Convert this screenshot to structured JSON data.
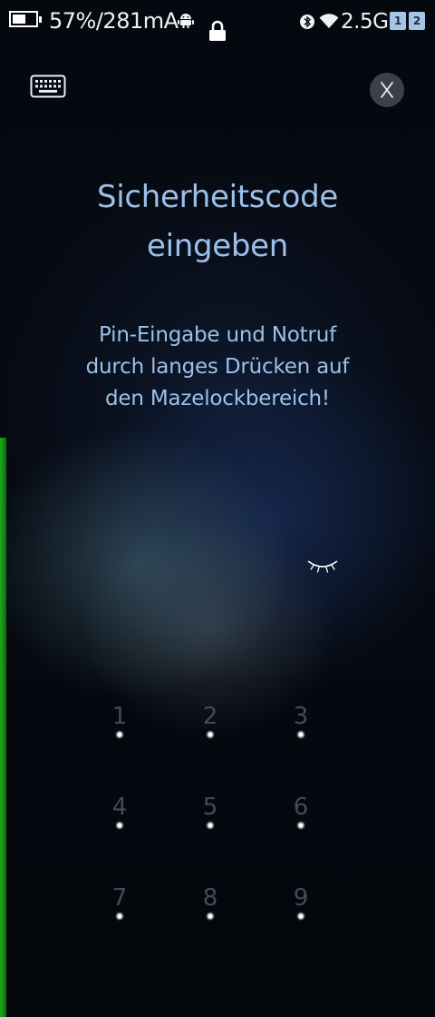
{
  "status_bar": {
    "battery_text": "57%/281mA",
    "network_text": "2.5G",
    "sim1": "1",
    "sim2": "2",
    "icons": [
      "battery-icon",
      "android-icon",
      "lock-icon",
      "bluetooth-icon",
      "wifi-icon",
      "sim1-icon",
      "sim2-icon"
    ]
  },
  "top_actions": {
    "keyboard_icon": "keyboard-icon",
    "close_icon": "close-icon"
  },
  "title": "Sicherheitscode\neingeben",
  "subtitle": "Pin-Eingabe und Notruf\ndurch langes Drücken auf\nden Mazelockbereich!",
  "visibility_icon": "eye-closed-icon",
  "keypad": {
    "keys": [
      "1",
      "2",
      "3",
      "4",
      "5",
      "6",
      "7",
      "8",
      "9"
    ]
  },
  "colors": {
    "text_accent": "#9cc0ea",
    "side_bar": "#1fa81a",
    "close_button_bg": "#3b4148"
  }
}
